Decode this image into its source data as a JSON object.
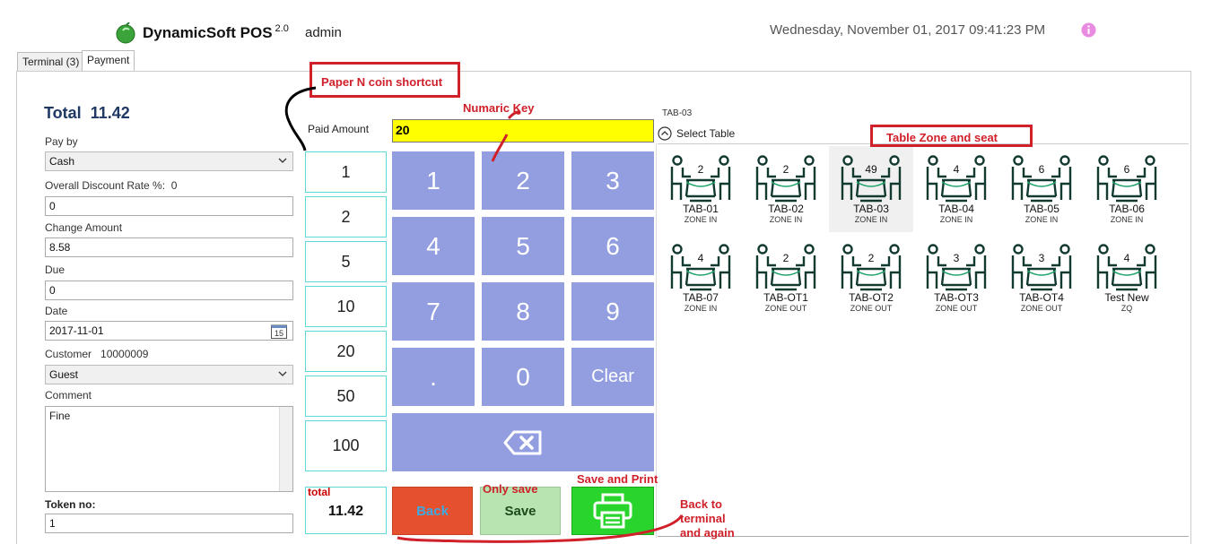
{
  "header": {
    "app_name": "DynamicSoft POS",
    "version": "2.0",
    "user": "admin",
    "datetime": "Wednesday,  November 01,  2017  09:41:23  PM"
  },
  "tabs": [
    {
      "label": "Terminal (3)"
    },
    {
      "label": "Payment"
    }
  ],
  "payment": {
    "total_label": "Total",
    "total_value": "11.42",
    "pay_by_label": "Pay by",
    "pay_by_value": "Cash",
    "discount_label": "Overall Discount Rate %:",
    "discount_rate": "0",
    "discount_value": "0",
    "change_label": "Change Amount",
    "change_value": "8.58",
    "due_label": "Due",
    "due_value": "0",
    "date_label": "Date",
    "date_value": "2017-11-01",
    "calendar_day": "15",
    "customer_label": "Customer",
    "customer_id": "10000009",
    "customer_value": "Guest",
    "comment_label": "Comment",
    "comment_value": "Fine",
    "token_label": "Token no:",
    "token_value": "1"
  },
  "keypad": {
    "paid_label": "Paid Amount",
    "paid_value": "20",
    "coins": [
      "1",
      "2",
      "5",
      "10",
      "20",
      "50",
      "100"
    ],
    "keys": [
      "1",
      "2",
      "3",
      "4",
      "5",
      "6",
      "7",
      "8",
      "9",
      ".",
      "0",
      "Clear"
    ],
    "total_label": "total",
    "total_value": "11.42",
    "back_label": "Back",
    "save_label": "Save"
  },
  "tables": {
    "current": "TAB-03",
    "select_label": "Select Table",
    "items": [
      {
        "name": "TAB-01",
        "zone": "ZONE IN",
        "seats": "2",
        "selected": false
      },
      {
        "name": "TAB-02",
        "zone": "ZONE IN",
        "seats": "2",
        "selected": false
      },
      {
        "name": "TAB-03",
        "zone": "ZONE IN",
        "seats": "49",
        "selected": true
      },
      {
        "name": "TAB-04",
        "zone": "ZONE IN",
        "seats": "4",
        "selected": false
      },
      {
        "name": "TAB-05",
        "zone": "ZONE IN",
        "seats": "6",
        "selected": false
      },
      {
        "name": "TAB-06",
        "zone": "ZONE IN",
        "seats": "6",
        "selected": false
      },
      {
        "name": "TAB-07",
        "zone": "ZONE IN",
        "seats": "4",
        "selected": false
      },
      {
        "name": "TAB-OT1",
        "zone": "ZONE OUT",
        "seats": "2",
        "selected": false
      },
      {
        "name": "TAB-OT2",
        "zone": "ZONE OUT",
        "seats": "2",
        "selected": false
      },
      {
        "name": "TAB-OT3",
        "zone": "ZONE OUT",
        "seats": "3",
        "selected": false
      },
      {
        "name": "TAB-OT4",
        "zone": "ZONE OUT",
        "seats": "3",
        "selected": false
      },
      {
        "name": "Test New",
        "zone": "ZQ",
        "seats": "4",
        "selected": false
      }
    ]
  },
  "annotations": {
    "coin_shortcut": "Paper N coin shortcut",
    "numeric_key": "Numaric Key",
    "table_zone": "Table Zone and  seat",
    "only_save": "Only save",
    "save_print": "Save and Print",
    "back_terminal": "Back to\nterminal\nand again"
  },
  "colors": {
    "keypad": "#929ee0",
    "paid_input": "#ffff00",
    "back_button": "#e5502f",
    "save_button": "#b7e4b0",
    "print_button": "#29d52d",
    "annotation": "#d0202a",
    "table_icon": "#123a30"
  }
}
